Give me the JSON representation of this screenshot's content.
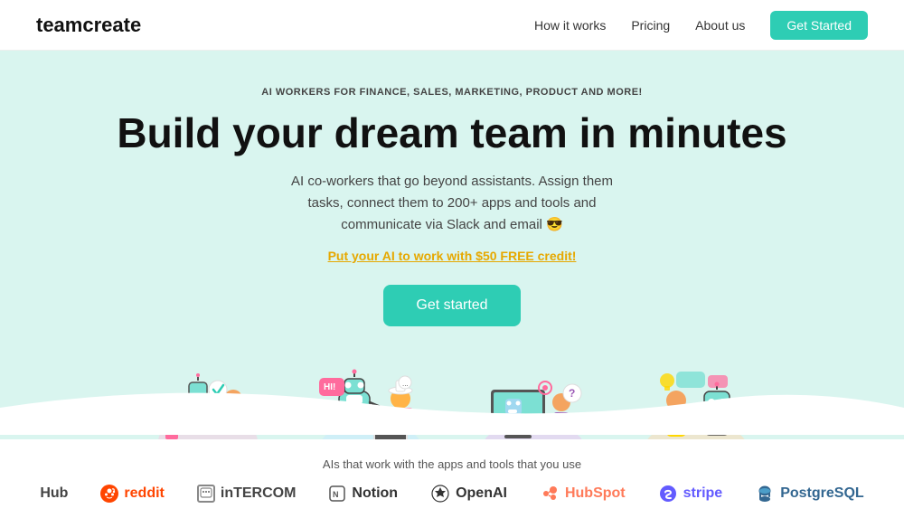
{
  "nav": {
    "logo_prefix": "team",
    "logo_bold": "create",
    "links": [
      "How it works",
      "Pricing",
      "About us"
    ],
    "cta": "Get Started"
  },
  "hero": {
    "badge": "AI WORKERS FOR FINANCE, SALES, MARKETING, PRODUCT AND MORE!",
    "title": "Build your dream team in minutes",
    "subtitle": "AI co-workers that go beyond assistants. Assign them tasks, connect them to 200+ apps and tools and communicate via Slack and email 😎",
    "credit_link": "Put your AI to work with $50 FREE credit!",
    "cta": "Get started"
  },
  "logos": {
    "title": "AIs that work with the apps and tools that you use",
    "items": [
      {
        "name": "Hub",
        "icon": ""
      },
      {
        "name": "reddit",
        "type": "reddit"
      },
      {
        "name": "INTERCOM",
        "type": "intercom"
      },
      {
        "name": "Notion",
        "type": "notion"
      },
      {
        "name": "OpenAI",
        "type": "openai"
      },
      {
        "name": "HubSpot",
        "type": "hubspot"
      },
      {
        "name": "stripe",
        "type": "stripe"
      },
      {
        "name": "PostgreSQL",
        "type": "postgres"
      }
    ]
  }
}
